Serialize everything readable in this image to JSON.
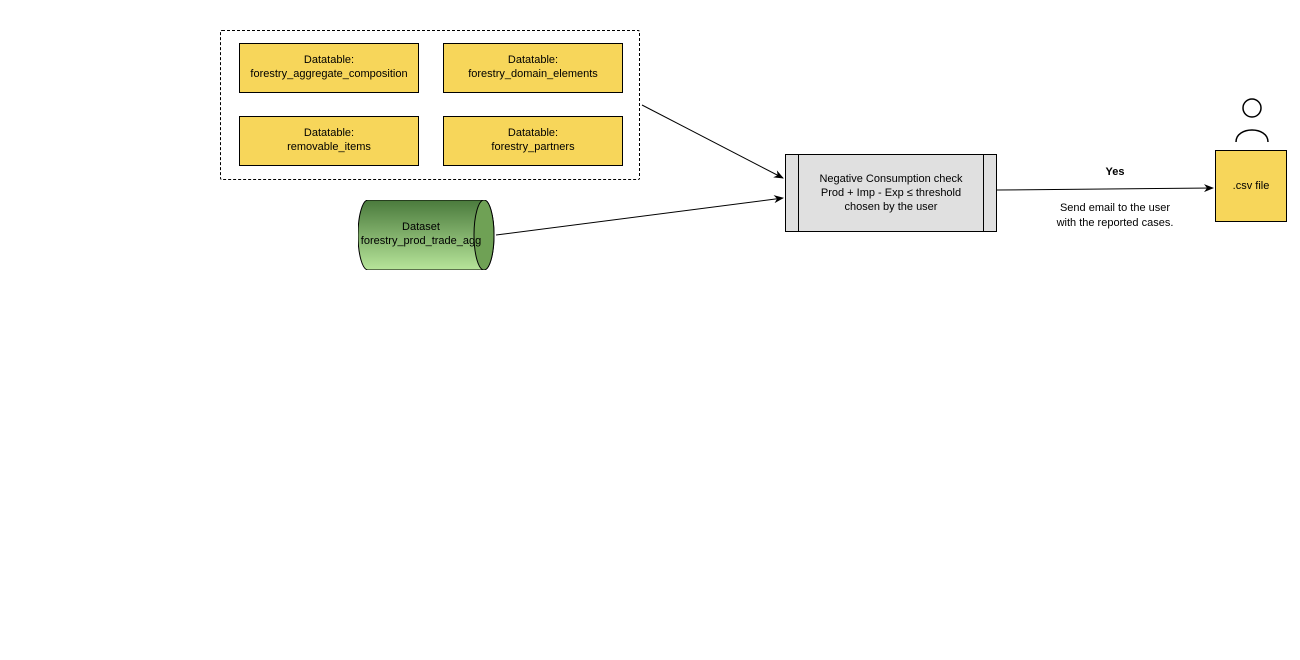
{
  "group": {
    "datatable1": {
      "prefix": "Datatable:",
      "name": "forestry_aggregate_composition"
    },
    "datatable2": {
      "prefix": "Datatable:",
      "name": "forestry_domain_elements"
    },
    "datatable3": {
      "prefix": "Datatable:",
      "name": "removable_items"
    },
    "datatable4": {
      "prefix": "Datatable:",
      "name": "forestry_partners"
    }
  },
  "dataset": {
    "prefix": "Dataset",
    "name": "forestry_prod_trade_agg"
  },
  "process": {
    "line1": "Negative Consumption check",
    "line2": "Prod + Imp - Exp  ≤  threshold",
    "line3": "chosen by the user"
  },
  "edge": {
    "yes": "Yes",
    "send1": "Send email to the user",
    "send2": "with the reported cases."
  },
  "output": {
    "label": ".csv file"
  }
}
